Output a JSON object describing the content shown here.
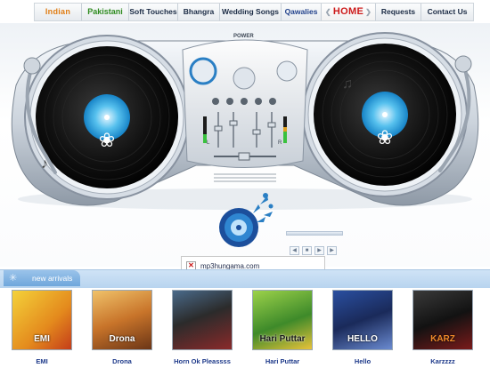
{
  "nav": {
    "indian": "Indian",
    "pakistani": "Pakistani",
    "soft": "Soft Touches",
    "bhangra": "Bhangra",
    "wedding": "Wedding Songs",
    "qawalies": "Qawalies",
    "home": "HOME",
    "requests": "Requests",
    "contact": "Contact Us"
  },
  "mixer": {
    "power_label": "POWER",
    "left_label": "L",
    "right_label": "R"
  },
  "broken_image": {
    "text": "mp3hungama.com"
  },
  "arrivals": {
    "label": "new arrivals",
    "albums": [
      {
        "name": "EMI",
        "cover_text": "EMI"
      },
      {
        "name": "Drona",
        "cover_text": "Drona"
      },
      {
        "name": "Horn Ok Pleassss",
        "cover_text": ""
      },
      {
        "name": "Hari Puttar",
        "cover_text": "Hari Puttar"
      },
      {
        "name": "Hello",
        "cover_text": "HELLO"
      },
      {
        "name": "Karzzzz",
        "cover_text": "KARZ"
      }
    ]
  },
  "colors": {
    "accent_blue": "#2a7fc4",
    "nav_home_red": "#cc1a1a",
    "nav_indian_orange": "#e07c13",
    "nav_pak_green": "#2d8a1e"
  }
}
